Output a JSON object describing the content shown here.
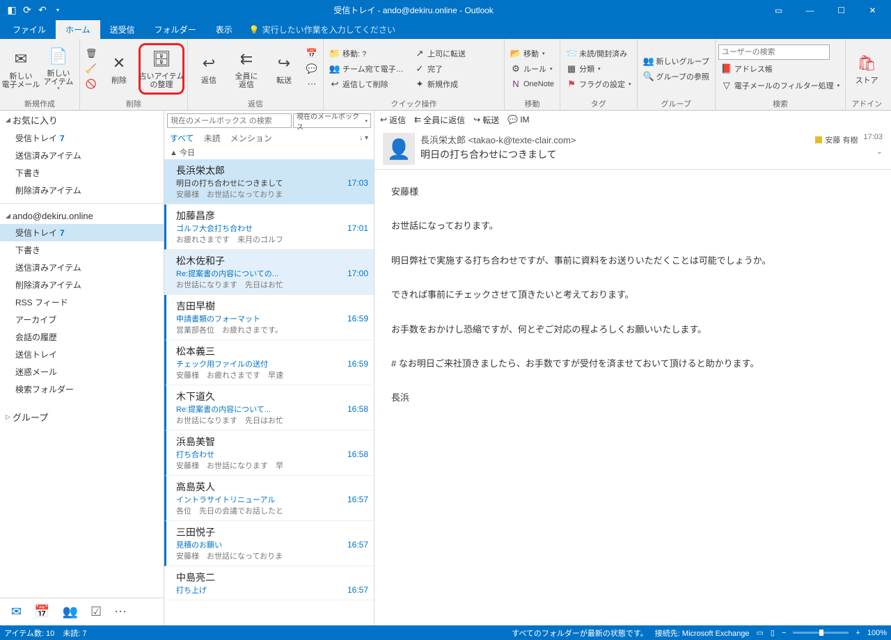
{
  "titlebar": {
    "title": "受信トレイ - ando@dekiru.online - Outlook"
  },
  "tabs": {
    "file": "ファイル",
    "home": "ホーム",
    "sendrecv": "送受信",
    "folder": "フォルダー",
    "view": "表示",
    "tellme": "実行したい作業を入力してください"
  },
  "ribbon": {
    "new_email": "新しい\n電子メール",
    "new_items": "新しい\nアイテム",
    "group_new": "新規作成",
    "delete": "削除",
    "archive": "古いアイテム\nの整理",
    "group_delete": "削除",
    "reply": "返信",
    "reply_all": "全員に\n返信",
    "forward": "転送",
    "group_reply": "返信",
    "qs_move": "移動: ?",
    "qs_team": "チーム宛て電子…",
    "qs_replydel": "返信して削除",
    "qs_boss": "上司に転送",
    "qs_done": "完了",
    "qs_create": "新規作成",
    "group_quick": "クイック操作",
    "move": "移動",
    "rules": "ルール",
    "onenote": "OneNote",
    "group_move": "移動",
    "unread": "未読/開封済み",
    "categorize": "分類",
    "flag": "フラグの設定",
    "group_tag": "タグ",
    "newgroup": "新しいグループ",
    "browsegroup": "グループの参照",
    "group_groups": "グループ",
    "search_placeholder": "ユーザーの検索",
    "addressbook": "アドレス帳",
    "filter": "電子メールのフィルター処理",
    "group_search": "検索",
    "store": "ストア",
    "group_addin": "アドイン"
  },
  "nav": {
    "favorites": "お気に入り",
    "fav_items": [
      {
        "label": "受信トレイ",
        "count": "7"
      },
      {
        "label": "送信済みアイテム"
      },
      {
        "label": "下書き"
      },
      {
        "label": "削除済みアイテム"
      }
    ],
    "account": "ando@dekiru.online",
    "acc_items": [
      {
        "label": "受信トレイ",
        "count": "7",
        "selected": true
      },
      {
        "label": "下書き"
      },
      {
        "label": "送信済みアイテム"
      },
      {
        "label": "削除済みアイテム"
      },
      {
        "label": "RSS フィード"
      },
      {
        "label": "アーカイブ"
      },
      {
        "label": "会話の履歴"
      },
      {
        "label": "送信トレイ"
      },
      {
        "label": "迷惑メール"
      },
      {
        "label": "検索フォルダー"
      }
    ],
    "groups": "グループ"
  },
  "msglist": {
    "search_placeholder": "現在のメールボックス の検索",
    "scope": "現在のメールボックス",
    "filter_all": "すべて",
    "filter_unread": "未読",
    "filter_mention": "メンション",
    "date_header": "▲ 今日",
    "items": [
      {
        "from": "長浜栄太郎",
        "subj": "明日の打ち合わせにつきまして",
        "prev": "安藤様　お世話になっておりま",
        "time": "17:03",
        "state": "sel"
      },
      {
        "from": "加藤昌彦",
        "subj": "ゴルフ大会打ち合わせ",
        "prev": "お疲れさまです　来月のゴルフ",
        "time": "17:01",
        "state": "unread"
      },
      {
        "from": "松木佐和子",
        "subj": "Re:提案書の内容についての...",
        "prev": "お世話になります　先日はお忙",
        "time": "17:00",
        "state": "sel2"
      },
      {
        "from": "吉田早樹",
        "subj": "申請書類のフォーマット",
        "prev": "営業部各位　お疲れさまです。",
        "time": "16:59",
        "state": "unread"
      },
      {
        "from": "松本義三",
        "subj": "チェック用ファイルの送付",
        "prev": "安藤様　お疲れさまです　早速",
        "time": "16:59",
        "state": "unread"
      },
      {
        "from": "木下道久",
        "subj": "Re:提案書の内容について...",
        "prev": "お世話になります　先日はお忙",
        "time": "16:58",
        "state": "unread"
      },
      {
        "from": "浜島美智",
        "subj": "打ち合わせ",
        "prev": "安藤様　お世話になります　早",
        "time": "16:58",
        "state": "unread"
      },
      {
        "from": "高島英人",
        "subj": "イントラサイトリニューアル",
        "prev": "各位　先日の会議でお話したと",
        "time": "16:57",
        "state": "unread"
      },
      {
        "from": "三田悦子",
        "subj": "見積のお願い",
        "prev": "安藤様　お世話になっておりま",
        "time": "16:57",
        "state": "unread"
      },
      {
        "from": "中島亮二",
        "subj": "打ち上げ",
        "prev": "",
        "time": "16:57",
        "state": "read"
      }
    ]
  },
  "reading": {
    "act_reply": "返信",
    "act_replyall": "全員に返信",
    "act_forward": "転送",
    "act_im": "IM",
    "from": "長浜栄太郎 <takao-k@texte-clair.com>",
    "category": "安藤 有樹",
    "time": "17:03",
    "subject": "明日の打ち合わせにつきまして",
    "body": "安藤様\n\nお世話になっております。\n\n明日弊社で実施する打ち合わせですが、事前に資料をお送りいただくことは可能でしょうか。\n\nできれば事前にチェックさせて頂きたいと考えております。\n\nお手数をおかけし恐縮ですが、何とぞご対応の程よろしくお願いいたします。\n\n#  なお明日ご来社頂きましたら、お手数ですが受付を済ませておいて頂けると助かります。\n\n長浜"
  },
  "status": {
    "items": "アイテム数: 10",
    "unread": "未読: 7",
    "sync": "すべてのフォルダーが最新の状態です。",
    "conn": "接続先: Microsoft Exchange",
    "zoom": "100%"
  }
}
